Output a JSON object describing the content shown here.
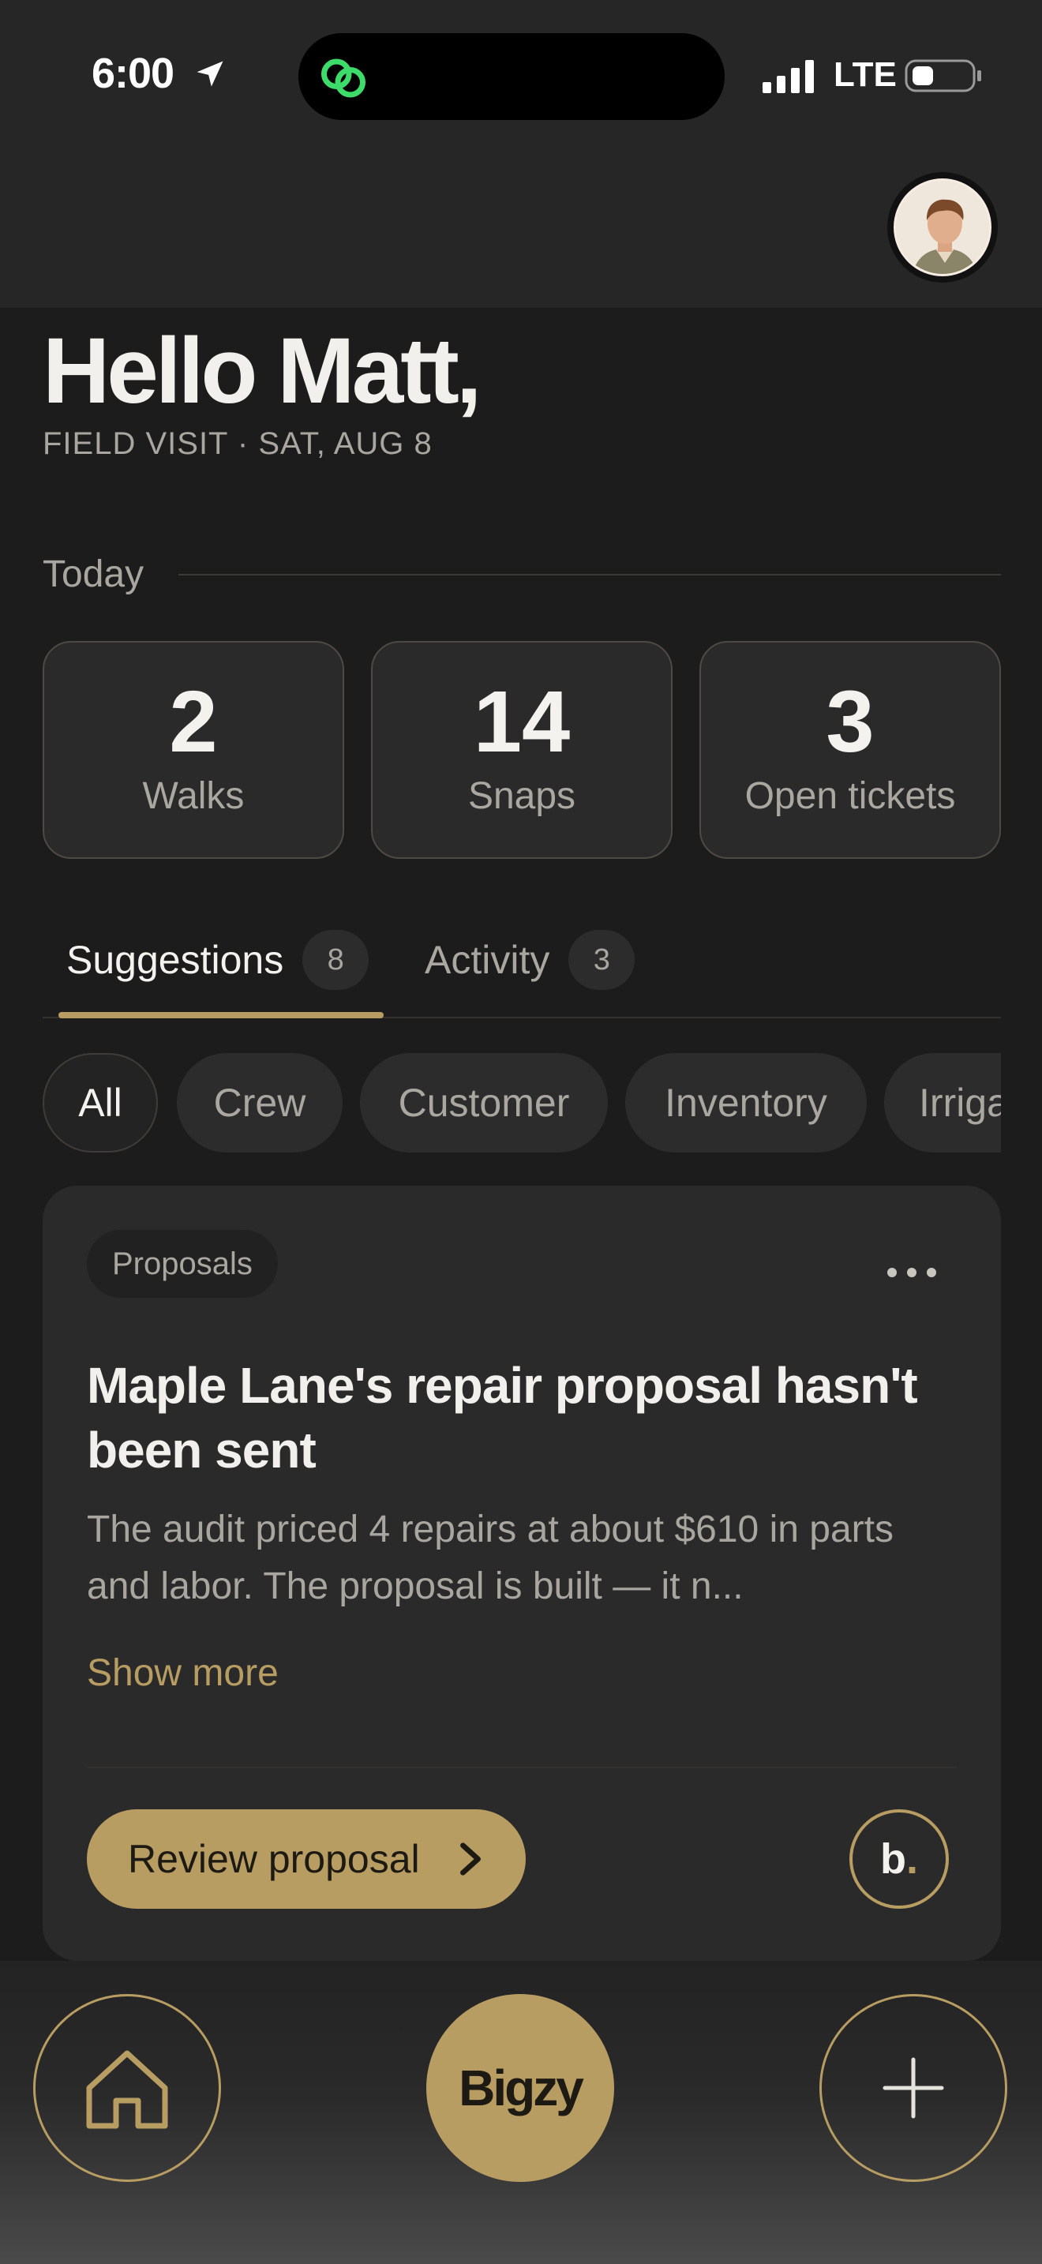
{
  "status_bar": {
    "time": "6:00",
    "network": "LTE"
  },
  "greeting": {
    "title": "Hello Matt,",
    "subtitle": "FIELD VISIT · SAT, AUG 8"
  },
  "today": {
    "label": "Today",
    "stats": [
      {
        "value": "2",
        "label": "Walks"
      },
      {
        "value": "14",
        "label": "Snaps"
      },
      {
        "value": "3",
        "label": "Open tickets"
      }
    ]
  },
  "tabs": [
    {
      "label": "Suggestions",
      "count": "8",
      "active": true
    },
    {
      "label": "Activity",
      "count": "3",
      "active": false
    }
  ],
  "filters": [
    {
      "label": "All",
      "active": true
    },
    {
      "label": "Crew"
    },
    {
      "label": "Customer"
    },
    {
      "label": "Inventory"
    },
    {
      "label": "Irrigation"
    }
  ],
  "card": {
    "tag": "Proposals",
    "title": "Maple Lane's repair proposal hasn't been sent",
    "body": "The audit priced 4 repairs at about $610 in parts and labor. The proposal is built — it n...",
    "show_more": "Show more",
    "action_label": "Review proposal",
    "badge_letter": "b",
    "badge_dot": "."
  },
  "bottom_nav": {
    "center_label": "Bigzy"
  },
  "colors": {
    "accent": "#b89d62",
    "background": "#1c1c1c",
    "card": "#2a2a2a",
    "island_icon": "#3ddc6a"
  },
  "icons": [
    "location-arrow-icon",
    "island-app-icon",
    "signal-icon",
    "battery-icon",
    "more-icon",
    "chevron-right-icon",
    "home-icon",
    "plus-icon"
  ]
}
